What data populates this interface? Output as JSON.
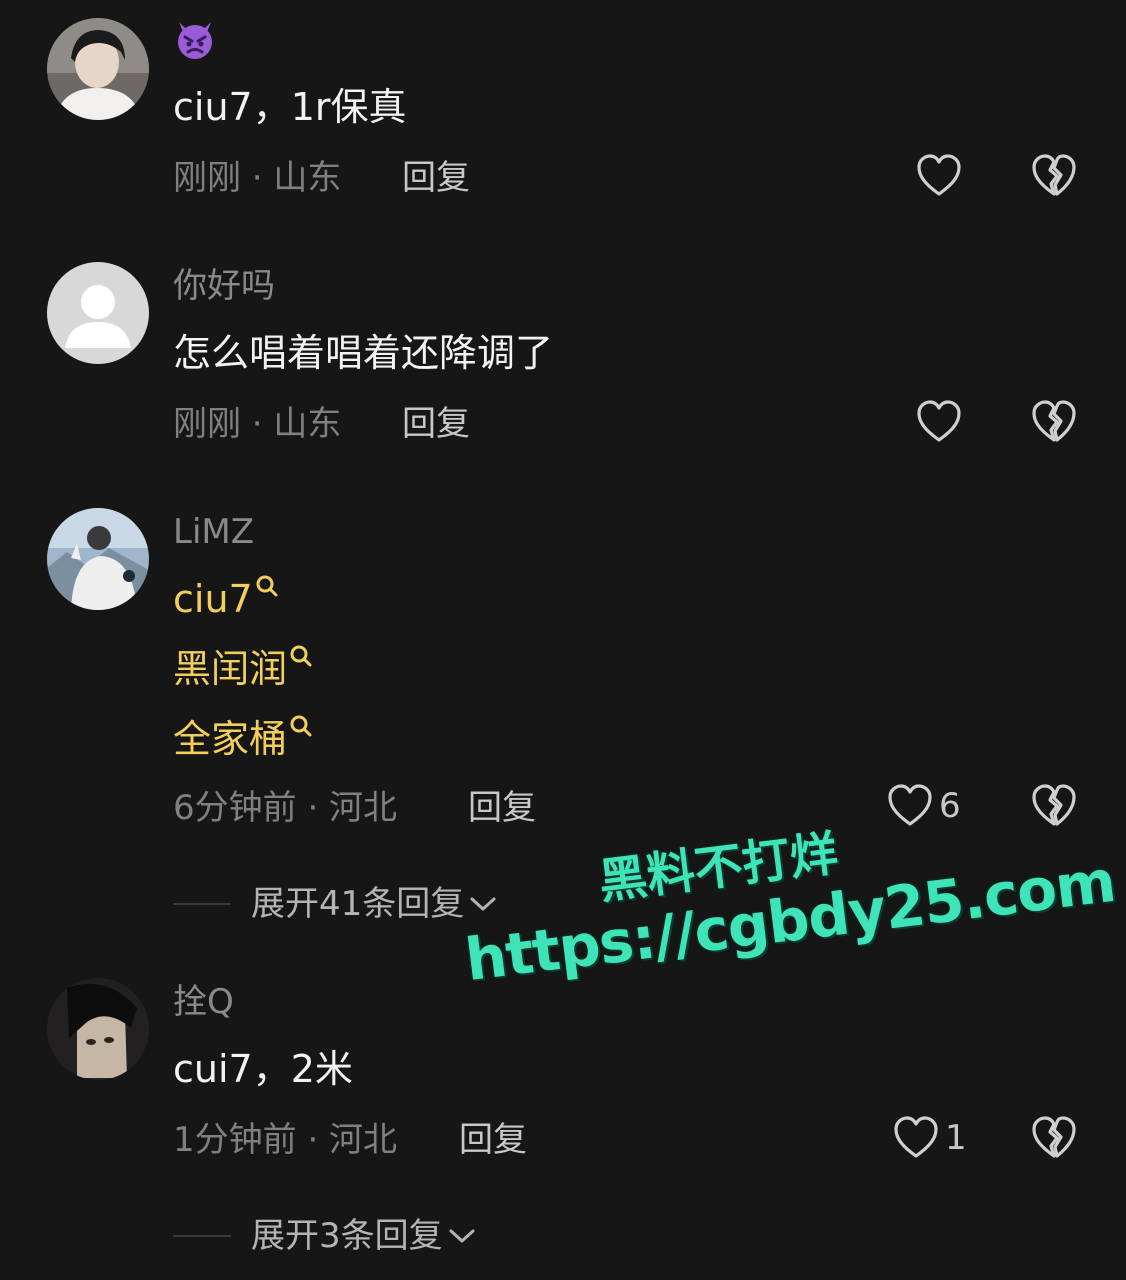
{
  "comments": [
    {
      "username": "😈",
      "text": "ciu7，1r保真",
      "meta": "刚刚 · 山东",
      "reply_label": "回复",
      "like_count": ""
    },
    {
      "username": "你好吗",
      "text": "怎么唱着唱着还降调了",
      "meta": "刚刚 · 山东",
      "reply_label": "回复",
      "like_count": ""
    },
    {
      "username": "LiMZ",
      "mentions": [
        "ciu7",
        "黑闰润",
        "全家桶"
      ],
      "meta": "6分钟前 · 河北",
      "reply_label": "回复",
      "like_count": "6",
      "expand_label": "展开41条回复"
    },
    {
      "username": "拴Q",
      "text": "cui7，2米",
      "meta": "1分钟前 · 河北",
      "reply_label": "回复",
      "like_count": "1",
      "expand_label": "展开3条回复"
    }
  ],
  "watermark": {
    "title": "黑料不打烊",
    "url": "https://cgbdy25.com"
  },
  "colors": {
    "background": "#161616",
    "mention": "#f2cf5a",
    "watermark": "#3ee3b8"
  },
  "icons": [
    "heart-icon",
    "broken-heart-icon",
    "search-icon",
    "chevron-down-icon",
    "devil-emoji-icon"
  ]
}
